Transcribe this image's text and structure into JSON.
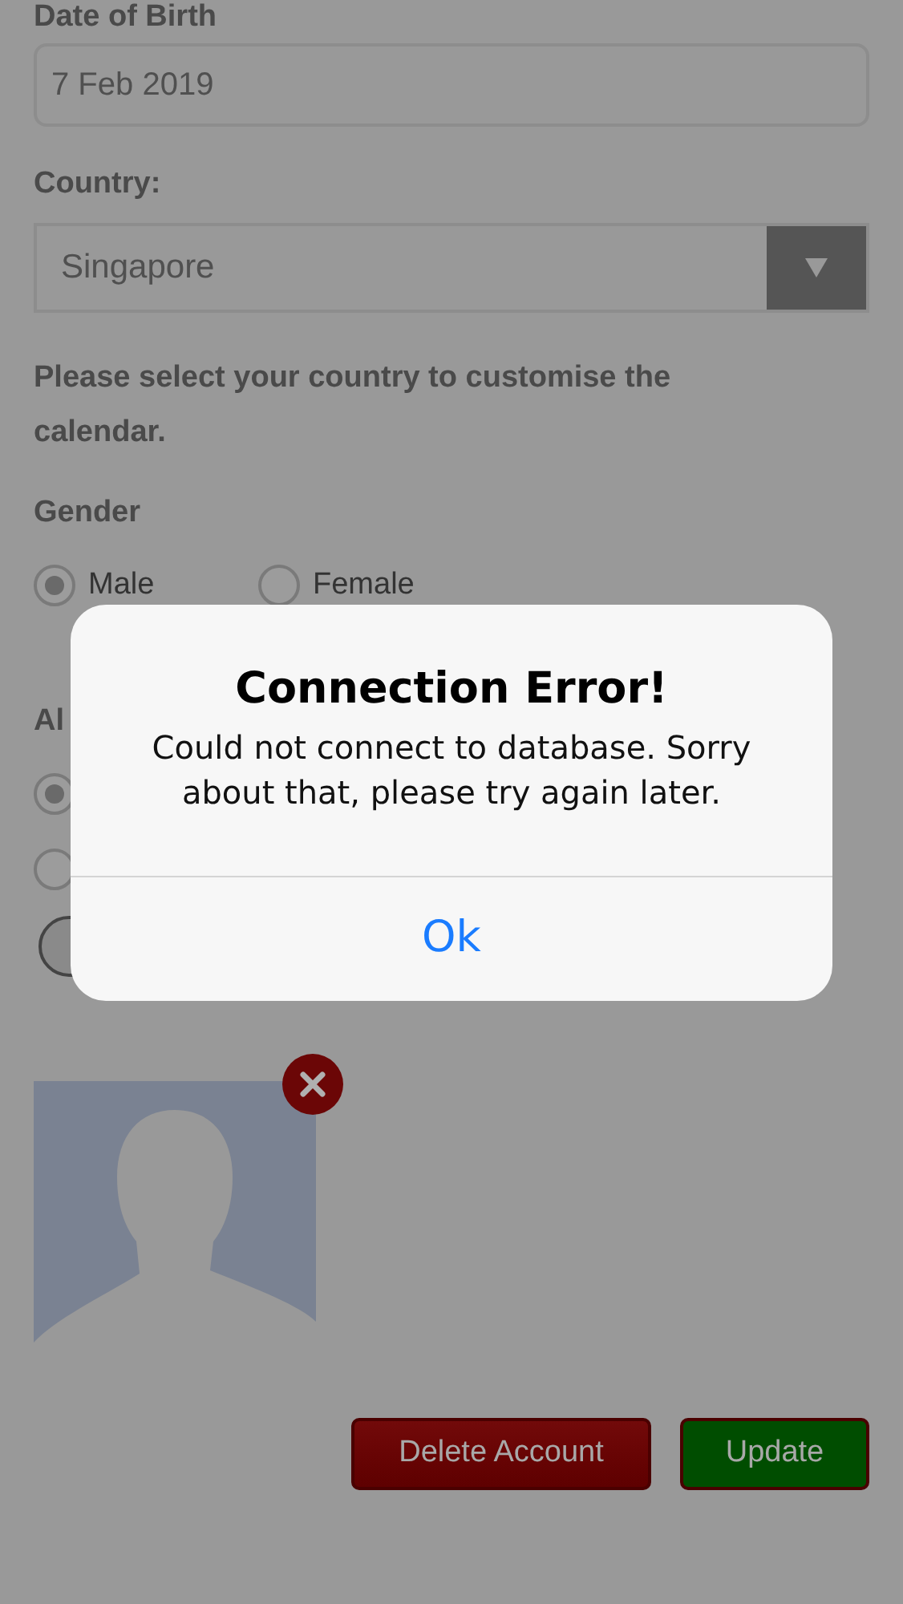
{
  "date_of_birth": {
    "label": "Date of Birth",
    "value": "7 Feb 2019"
  },
  "country": {
    "label": "Country:",
    "value": "Singapore"
  },
  "help_text": "Please select your country to customise the calendar.",
  "gender": {
    "label": "Gender",
    "options": [
      {
        "label": "Male",
        "selected": true
      },
      {
        "label": "Female",
        "selected": false
      }
    ]
  },
  "section_2": {
    "label": "Al",
    "options": [
      {
        "selected": true
      },
      {
        "selected": false
      }
    ]
  },
  "buttons": [
    {
      "label": "Delete Account",
      "kind": "danger"
    },
    {
      "label": "Update",
      "kind": "primary"
    }
  ],
  "alert": {
    "title": "Connection Error!",
    "message": "Could not connect to database. Sorry about that, please try again later.",
    "button": "Ok"
  }
}
